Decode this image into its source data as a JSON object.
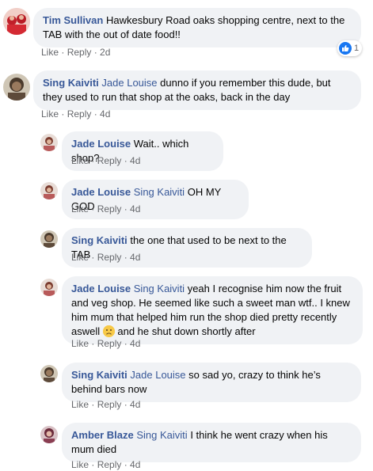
{
  "comments": [
    {
      "author": "Tim Sullivan",
      "mention": "",
      "text": "Hawkesbury Road oaks shopping centre, next to the TAB with the out of date food!!",
      "like": "Like",
      "reply": "Reply",
      "time": "2d",
      "reactions": "1"
    },
    {
      "author": "Sing Kaiviti",
      "mention": "Jade Louise",
      "text": "dunno if you remember this dude, but they used to run that shop at the oaks, back in the day",
      "like": "Like",
      "reply": "Reply",
      "time": "4d"
    },
    {
      "author": "Jade Louise",
      "mention": "",
      "text": "Wait.. which shop?",
      "like": "Like",
      "reply": "Reply",
      "time": "4d"
    },
    {
      "author": "Jade Louise",
      "mention": "Sing Kaiviti",
      "text": "OH MY GOD",
      "like": "Like",
      "reply": "Reply",
      "time": "4d"
    },
    {
      "author": "Sing Kaiviti",
      "mention": "",
      "text": "the one that used to be next to the TAB",
      "like": "Like",
      "reply": "Reply",
      "time": "4d"
    },
    {
      "author": "Jade Louise",
      "mention": "Sing Kaiviti",
      "text": "yeah I recognise him now the fruit and veg shop. He seemed like such a sweet man wtf.. I knew him mum that helped him run the shop died pretty recently aswell",
      "text_after": "and he shut down shortly after",
      "emoji": "worried-face-emoji",
      "like": "Like",
      "reply": "Reply",
      "time": "4d"
    },
    {
      "author": "Sing Kaiviti",
      "mention": "Jade Louise",
      "text": "so sad yo, crazy to think he’s behind bars now",
      "like": "Like",
      "reply": "Reply",
      "time": "4d"
    },
    {
      "author": "Amber Blaze",
      "mention": "Sing Kaiviti",
      "text": "I think he went crazy when his mum died",
      "like": "Like",
      "reply": "Reply",
      "time": "4d"
    }
  ],
  "colors": {
    "link": "#385898",
    "bubble": "#f0f2f5",
    "meta": "#65676b",
    "like_blue": "#1877f2"
  }
}
